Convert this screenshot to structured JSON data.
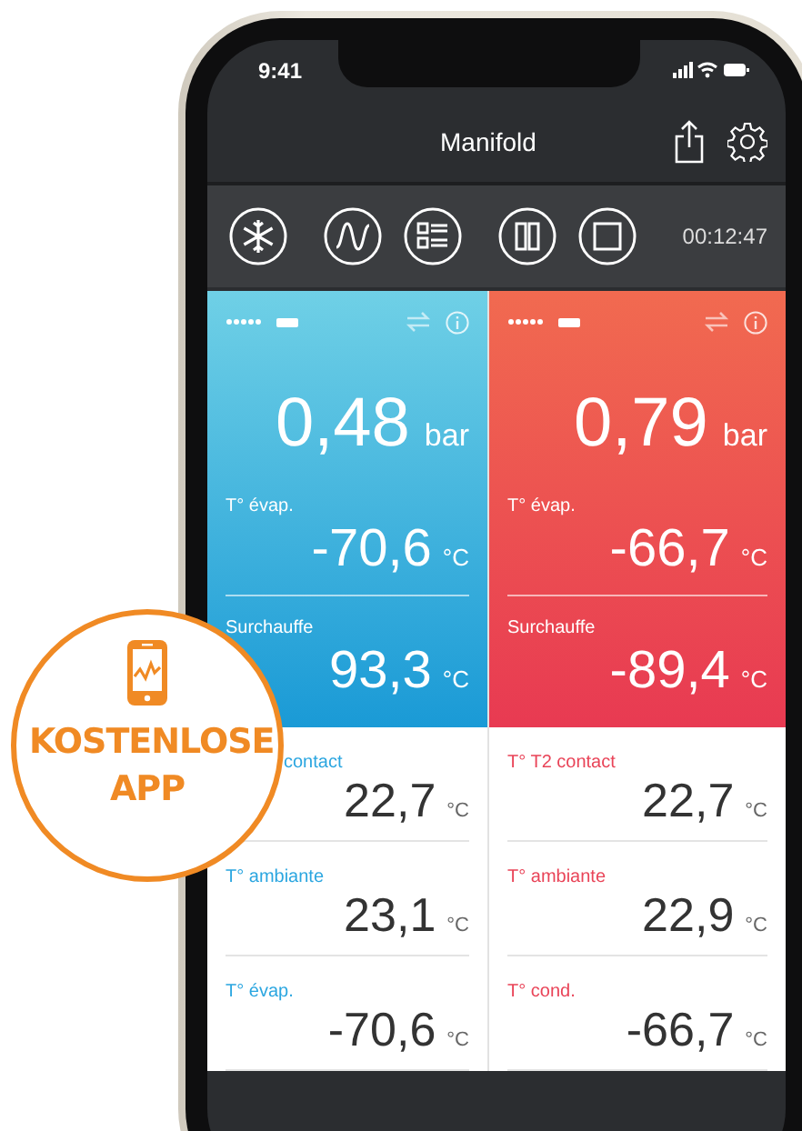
{
  "status_bar": {
    "time": "9:41"
  },
  "nav": {
    "title": "Manifold"
  },
  "toolbar": {
    "timer": "00:12:47"
  },
  "panels": [
    {
      "kind": "low",
      "pressure": "0,48",
      "pressure_unit": "bar",
      "temp_label": "T° évap.",
      "temp": "-70,6",
      "temp_unit": "°C",
      "sh_label": "Surchauffe",
      "sh": "93,3",
      "sh_unit": "°C",
      "readings": [
        {
          "kind": "covered",
          "label": "contact",
          "value": "22,7",
          "unit": "°C"
        },
        {
          "kind": "plain",
          "label": "T° ambiante",
          "value": "23,1",
          "unit": "°C"
        },
        {
          "kind": "plain",
          "label": "T° évap.",
          "value": "-70,6",
          "unit": "°C"
        }
      ]
    },
    {
      "kind": "high",
      "pressure": "0,79",
      "pressure_unit": "bar",
      "temp_label": "T° évap.",
      "temp": "-66,7",
      "temp_unit": "°C",
      "sh_label": "Surchauffe",
      "sh": "-89,4",
      "sh_unit": "°C",
      "readings": [
        {
          "kind": "plain",
          "label": "T° T2 contact",
          "value": "22,7",
          "unit": "°C"
        },
        {
          "kind": "plain",
          "label": "T° ambiante",
          "value": "22,9",
          "unit": "°C"
        },
        {
          "kind": "plain",
          "label": "T° cond.",
          "value": "-66,7",
          "unit": "°C"
        }
      ]
    }
  ],
  "badge": {
    "text": "KOSTENLOSE APP"
  }
}
